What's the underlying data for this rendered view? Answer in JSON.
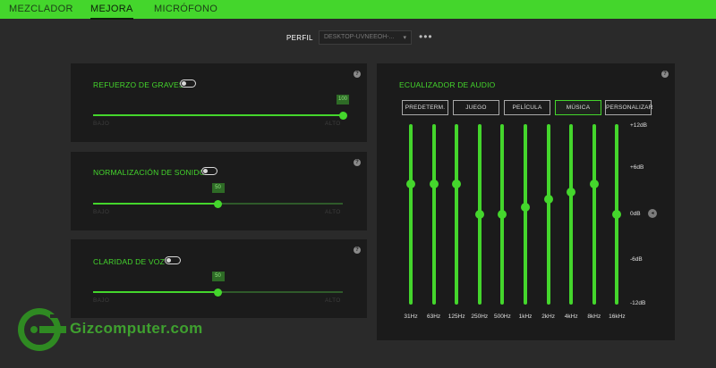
{
  "tabs": [
    {
      "label": "MEZCLADOR",
      "active": false
    },
    {
      "label": "MEJORA",
      "active": true
    },
    {
      "label": "MICRÓFONO",
      "active": false
    }
  ],
  "profile": {
    "label": "PERFIL",
    "value": "DESKTOP-UVNEEOH-...",
    "more": "•••"
  },
  "bass": {
    "title": "REFUERZO DE GRAVES",
    "enabled": false,
    "value": 100,
    "value_label": "100",
    "min_label": "BAJO",
    "max_label": "ALTO"
  },
  "normalization": {
    "title": "NORMALIZACIÓN DE SONIDO",
    "enabled": false,
    "value": 50,
    "value_label": "50",
    "min_label": "BAJO",
    "max_label": "ALTO"
  },
  "voice": {
    "title": "CLARIDAD DE VOZ",
    "enabled": false,
    "value": 50,
    "value_label": "50",
    "min_label": "BAJO",
    "max_label": "ALTO"
  },
  "help_icon": "?",
  "equalizer": {
    "title": "ECUALIZADOR DE AUDIO",
    "presets": [
      {
        "label": "PREDETERM.",
        "active": false
      },
      {
        "label": "JUEGO",
        "active": false
      },
      {
        "label": "PELÍCULA",
        "active": false
      },
      {
        "label": "MÚSICA",
        "active": true
      },
      {
        "label": "PERSONALIZAR",
        "active": false
      }
    ],
    "db_labels": [
      "+12dB",
      "+6dB",
      "0dB",
      "-6dB",
      "-12dB"
    ],
    "bands": [
      {
        "label": "31Hz",
        "db": 4
      },
      {
        "label": "63Hz",
        "db": 4
      },
      {
        "label": "125Hz",
        "db": 4
      },
      {
        "label": "250Hz",
        "db": 0
      },
      {
        "label": "500Hz",
        "db": 0
      },
      {
        "label": "1kHz",
        "db": 1
      },
      {
        "label": "2kHz",
        "db": 2
      },
      {
        "label": "4kHz",
        "db": 3
      },
      {
        "label": "8kHz",
        "db": 4
      },
      {
        "label": "16kHz",
        "db": 0
      }
    ],
    "range": [
      -12,
      12
    ]
  },
  "watermark": {
    "text": "Gizcomputer.com",
    "icon": "gizcomputer-logo-icon"
  },
  "colors": {
    "accent": "#44d62c",
    "panel": "#1b1b1b",
    "background": "#2a2a2a"
  }
}
